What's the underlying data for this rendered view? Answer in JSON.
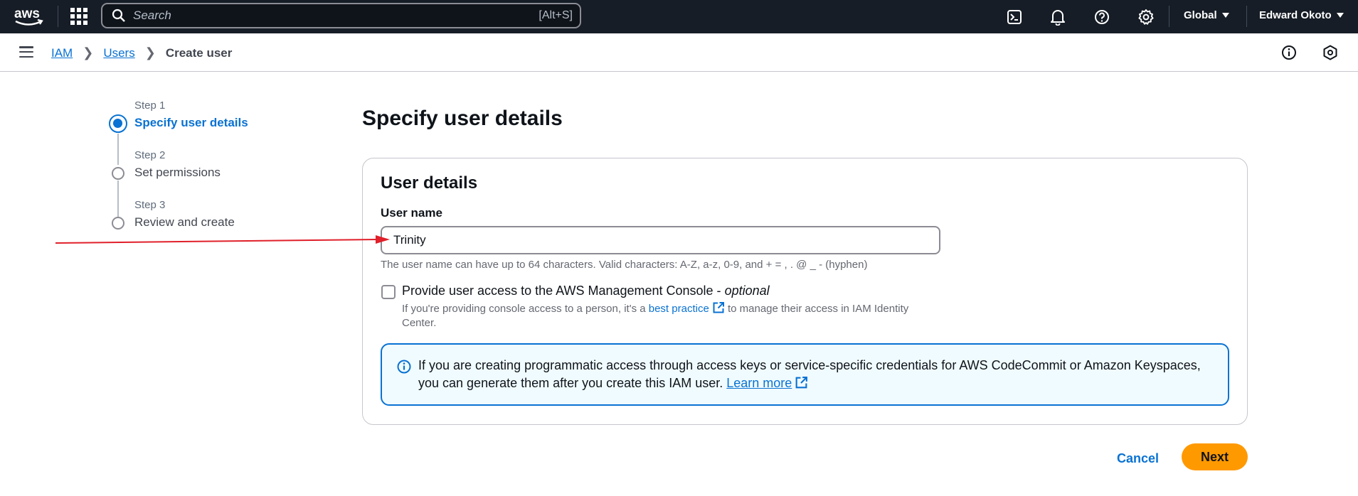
{
  "topnav": {
    "logo": "aws",
    "search_placeholder": "Search",
    "search_shortcut": "[Alt+S]",
    "icons": [
      "cloudshell-icon",
      "bell-icon",
      "help-icon",
      "settings-icon"
    ],
    "region": "Global",
    "account": "Edward Okoto"
  },
  "breadcrumb": {
    "items": [
      "IAM",
      "Users"
    ],
    "current": "Create user"
  },
  "steps": [
    {
      "label": "Step 1",
      "title": "Specify user details",
      "active": true
    },
    {
      "label": "Step 2",
      "title": "Set permissions",
      "active": false
    },
    {
      "label": "Step 3",
      "title": "Review and create",
      "active": false
    }
  ],
  "main": {
    "title": "Specify user details",
    "panel_title": "User details",
    "user_name_label": "User name",
    "user_name_value": "Trinity",
    "user_name_hint": "The user name can have up to 64 characters. Valid characters: A-Z, a-z, 0-9, and + = , . @ _ - (hyphen)",
    "console_access": {
      "label": "Provide user access to the AWS Management Console - ",
      "optional": "optional",
      "checked": false,
      "desc_before": "If you're providing console access to a person, it's a ",
      "desc_link": "best practice",
      "desc_after": " to manage their access in IAM Identity Center."
    },
    "alert": {
      "text": "If you are creating programmatic access through access keys or service-specific credentials for AWS CodeCommit or Amazon Keyspaces, you can generate them after you create this IAM user. ",
      "link": "Learn more"
    }
  },
  "footer": {
    "cancel_label": "Cancel",
    "next_label": "Next"
  },
  "colors": {
    "nav_bg": "#161d26",
    "link": "#0972d3",
    "primary_button": "#ff9900",
    "annotation_arrow": "#e0202a"
  }
}
